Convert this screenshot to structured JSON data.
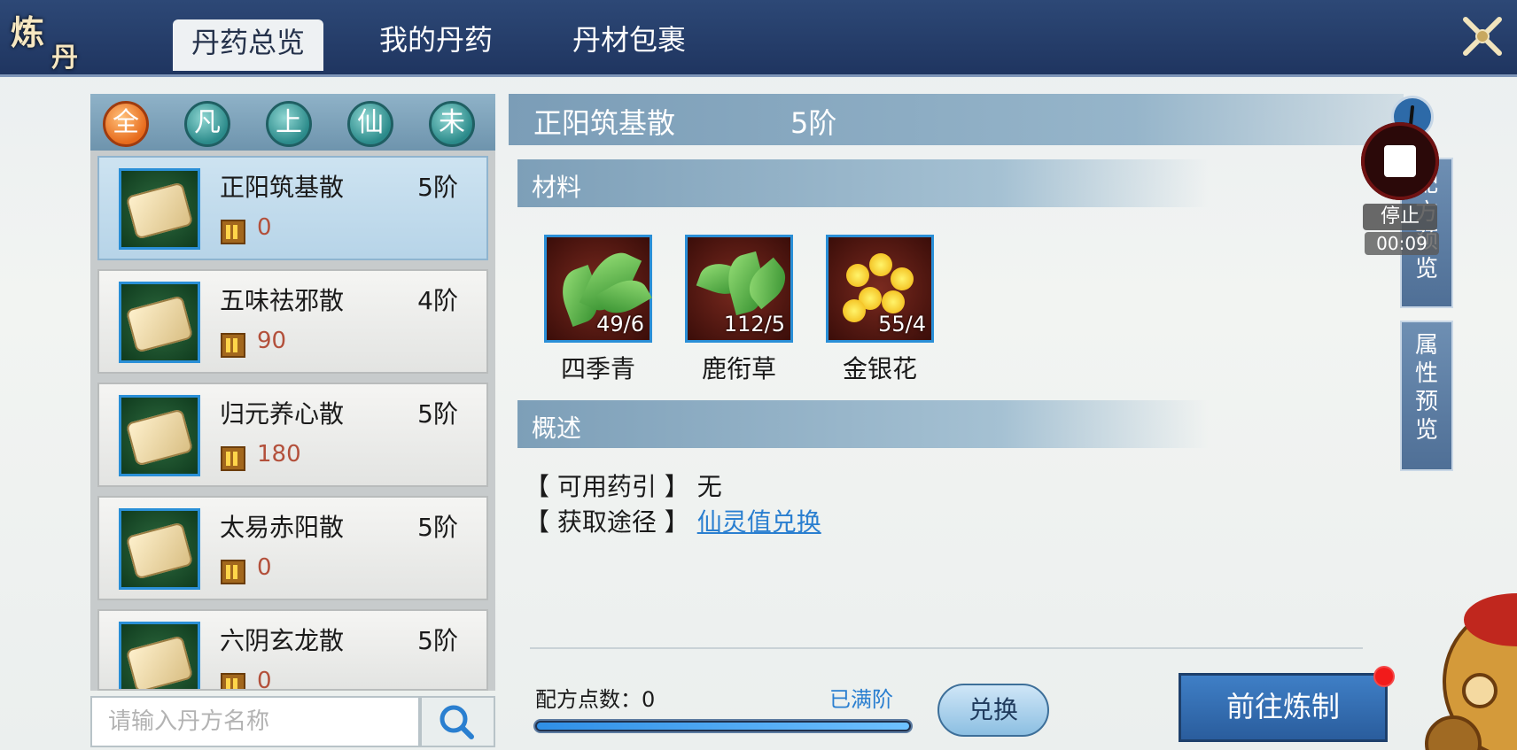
{
  "header": {
    "logo": "炼丹",
    "logo_top": "炼",
    "logo_bottom": "丹",
    "tabs": [
      {
        "label": "丹药总览",
        "active": true
      },
      {
        "label": "我的丹药",
        "active": false
      },
      {
        "label": "丹材包裹",
        "active": false
      }
    ]
  },
  "filters": [
    {
      "label": "全",
      "active": true
    },
    {
      "label": "凡",
      "active": false
    },
    {
      "label": "上",
      "active": false
    },
    {
      "label": "仙",
      "active": false
    },
    {
      "label": "未",
      "active": false
    }
  ],
  "recipes": [
    {
      "name": "正阳筑基散",
      "rank": "5阶",
      "count": "0",
      "selected": true
    },
    {
      "name": "五味祛邪散",
      "rank": "4阶",
      "count": "90",
      "selected": false
    },
    {
      "name": "归元养心散",
      "rank": "5阶",
      "count": "180",
      "selected": false
    },
    {
      "name": "太易赤阳散",
      "rank": "5阶",
      "count": "0",
      "selected": false
    },
    {
      "name": "六阴玄龙散",
      "rank": "5阶",
      "count": "0",
      "selected": false
    }
  ],
  "search": {
    "placeholder": "请输入丹方名称"
  },
  "detail": {
    "title": "正阳筑基散",
    "rank": "5阶",
    "materials_label": "材料",
    "materials": [
      {
        "name": "四季青",
        "count": "49/6"
      },
      {
        "name": "鹿衔草",
        "count": "112/5"
      },
      {
        "name": "金银花",
        "count": "55/4"
      }
    ],
    "overview_label": "概述",
    "guide_label": "【 可用药引 】",
    "guide_value": "无",
    "source_label": "【 获取途径 】",
    "source_link": "仙灵值兑换"
  },
  "footer": {
    "points_label": "配方点数：0",
    "maxed_label": "已满阶",
    "progress": 1.0,
    "exchange_button": "兑换",
    "go_button": "前往炼制"
  },
  "side_tabs": [
    {
      "label": "配方预览"
    },
    {
      "label": "属性预览"
    }
  ],
  "recorder": {
    "stop_label": "停止",
    "timer": "00:09"
  },
  "colors": {
    "header_bg": "#2d4876",
    "accent_blue": "#2a7fd0",
    "count_red": "#b3503b",
    "filter_active": "#e76b1c"
  }
}
